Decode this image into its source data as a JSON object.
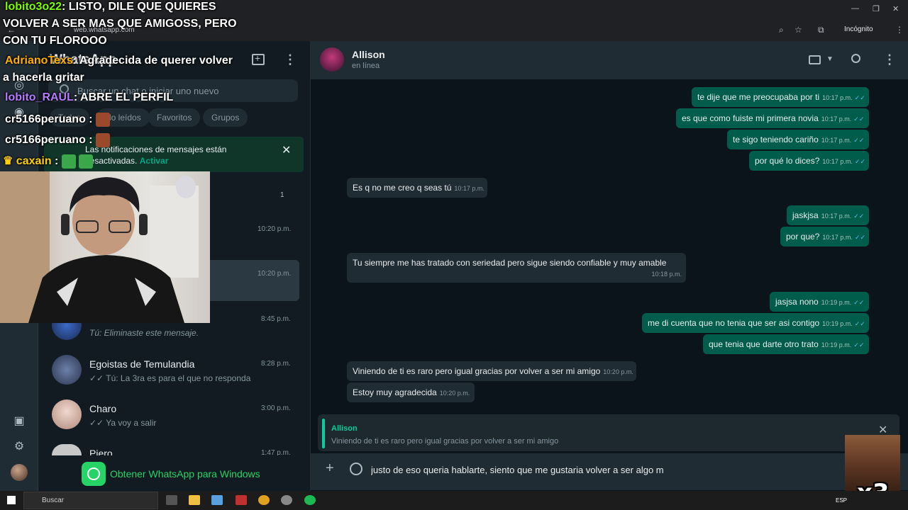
{
  "browser": {
    "url": "web.whatsapp.com",
    "incognito_label": "Incógnito"
  },
  "left": {
    "app_title": "WhatsApp",
    "search_placeholder": "Buscar un chat o iniciar uno nuevo",
    "filters": [
      "Todos",
      "No leídos",
      "Favoritos",
      "Grupos"
    ],
    "notification": {
      "text": "Las notificaciones de mensajes están desactivadas.",
      "action": "Activar"
    },
    "chats": [
      {
        "name": "",
        "preview": "",
        "time": "",
        "unread": "1"
      },
      {
        "name": "",
        "preview": "",
        "time": "10:20 p.m."
      },
      {
        "name": "",
        "preview": "",
        "time": "10:20 p.m."
      },
      {
        "name": "",
        "preview": "Tú: Eliminaste este mensaje.",
        "time": "8:45 p.m."
      },
      {
        "name": "Egoistas de Temulandia",
        "preview": "Tú: La 3ra es para el que no responda",
        "time": "8:28 p.m."
      },
      {
        "name": "Charo",
        "preview": "Ya voy a salir",
        "time": "3:00 p.m."
      },
      {
        "name": "Piero",
        "preview": "",
        "time": "1:47 p.m."
      }
    ],
    "get_app": "Obtener WhatsApp para Windows"
  },
  "stream_chat": [
    {
      "user": "lobito3o22",
      "color": "#7CFC00",
      "text": ": LISTO, DILE QUE QUIERES"
    },
    {
      "user": "",
      "color": "#ffffff",
      "text": "VOLVER A SER MAS QUE AMIGOSS, PERO"
    },
    {
      "user": "",
      "color": "#ffffff",
      "text": "CON TU FLOROOO"
    },
    {
      "user": "AdrianoTexs",
      "color": "#ffb000",
      "text": ": Agradecida de querer volver"
    },
    {
      "user": "",
      "color": "#ffffff",
      "text": "a hacerla gritar"
    },
    {
      "user": "lobito_RAUL",
      "color": "#b57bff",
      "text": ": ABRE EL PERFIL"
    },
    {
      "user": "cr5166peruano",
      "color": "#ffffff",
      "text": " :"
    },
    {
      "user": "cr5166peruano",
      "color": "#ffffff",
      "text": " :"
    },
    {
      "user": "caxain",
      "color": "#ffd000",
      "text": " :"
    }
  ],
  "chat": {
    "contact_name": "Allison",
    "contact_status": "en línea",
    "messages": [
      {
        "dir": "out",
        "text": "te dije que me preocupaba por ti",
        "time": "10:17 p.m."
      },
      {
        "dir": "out",
        "text": "es que como fuiste mi primera novia",
        "time": "10:17 p.m."
      },
      {
        "dir": "out",
        "text": "te sigo teniendo cariño",
        "time": "10:17 p.m."
      },
      {
        "dir": "out",
        "text": "por qué lo dices?",
        "time": "10:17 p.m."
      },
      {
        "dir": "in",
        "text": "Es q no me creo q seas tú",
        "time": "10:17 p.m."
      },
      {
        "dir": "out",
        "text": "jaskjsa",
        "time": "10:17 p.m."
      },
      {
        "dir": "out",
        "text": "por que?",
        "time": "10:17 p.m."
      },
      {
        "dir": "in",
        "text": "Tu siempre me has tratado con seriedad pero sigue siendo confiable y muy amable",
        "time": "10:18 p.m."
      },
      {
        "dir": "out",
        "text": "jasjsa nono",
        "time": "10:19 p.m."
      },
      {
        "dir": "out",
        "text": "me di cuenta que no tenia que ser asi contigo",
        "time": "10:19 p.m."
      },
      {
        "dir": "out",
        "text": "que tenia que darte otro trato",
        "time": "10:19 p.m."
      },
      {
        "dir": "in",
        "text": "Viniendo de ti es raro pero igual gracias por volver a ser mi amigo",
        "time": "10:20 p.m."
      },
      {
        "dir": "in",
        "text": "Estoy muy agradecida",
        "time": "10:20 p.m."
      }
    ],
    "reply": {
      "name": "Allison",
      "text": "Viniendo de ti es raro pero igual gracias por volver a ser mi amigo"
    },
    "composer_value": "justo de eso queria hablarte, siento que me gustaria volver a ser algo m"
  },
  "overlay": {
    "meme_text": "x3"
  },
  "taskbar": {
    "search_label": "Buscar",
    "lang": "ESP"
  },
  "colors": {
    "accent": "#00a884",
    "outgoing_bubble": "#005c4b",
    "incoming_bubble": "#202c33"
  }
}
